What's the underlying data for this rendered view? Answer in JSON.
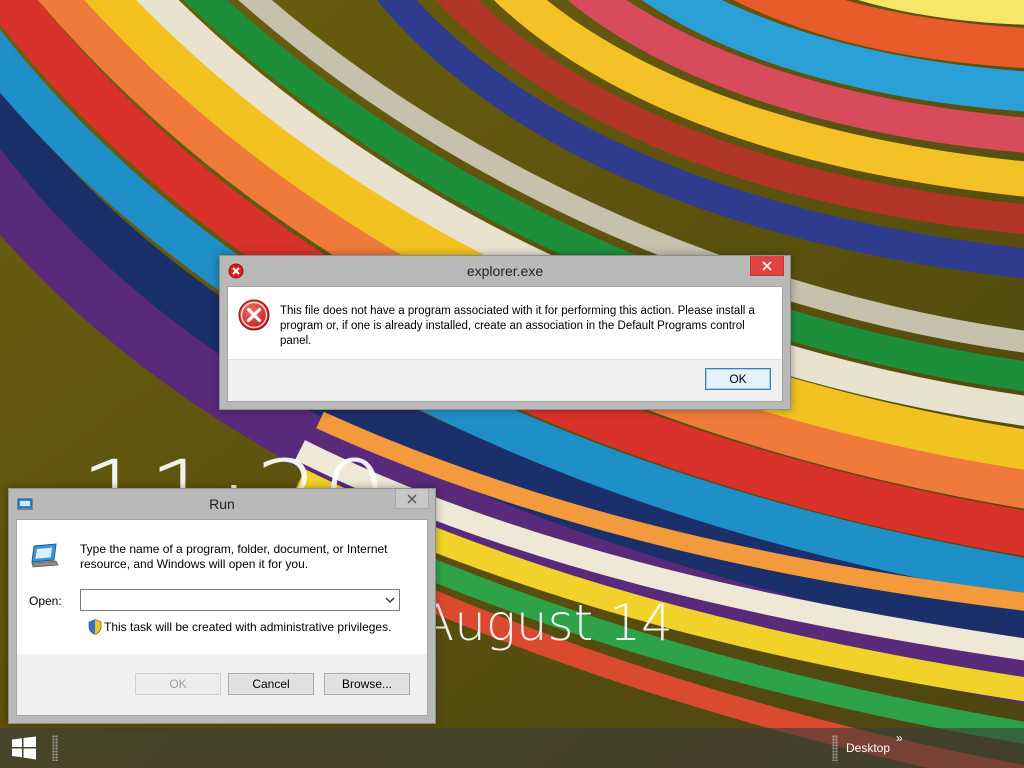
{
  "lock_screen": {
    "time": "11:30",
    "date": "August 14"
  },
  "error_dialog": {
    "title": "explorer.exe",
    "message": "This file does not have a program associated with it for performing this action. Please install a program or, if one is already installed, create an association in the Default Programs control panel.",
    "ok_label": "OK",
    "icon": "error-icon"
  },
  "run_dialog": {
    "title": "Run",
    "description": "Type the name of a program, folder, document, or Internet resource, and Windows will open it for you.",
    "open_label": "Open:",
    "open_value": "",
    "admin_note": "This task will be created with administrative privileges.",
    "ok_label": "OK",
    "cancel_label": "Cancel",
    "browse_label": "Browse..."
  },
  "taskbar": {
    "desktop_label": "Desktop",
    "chevron": "»"
  },
  "colors": {
    "close_active": "#e04343",
    "chrome": "#b9b9b9",
    "default_button": "#e5f1fb"
  }
}
